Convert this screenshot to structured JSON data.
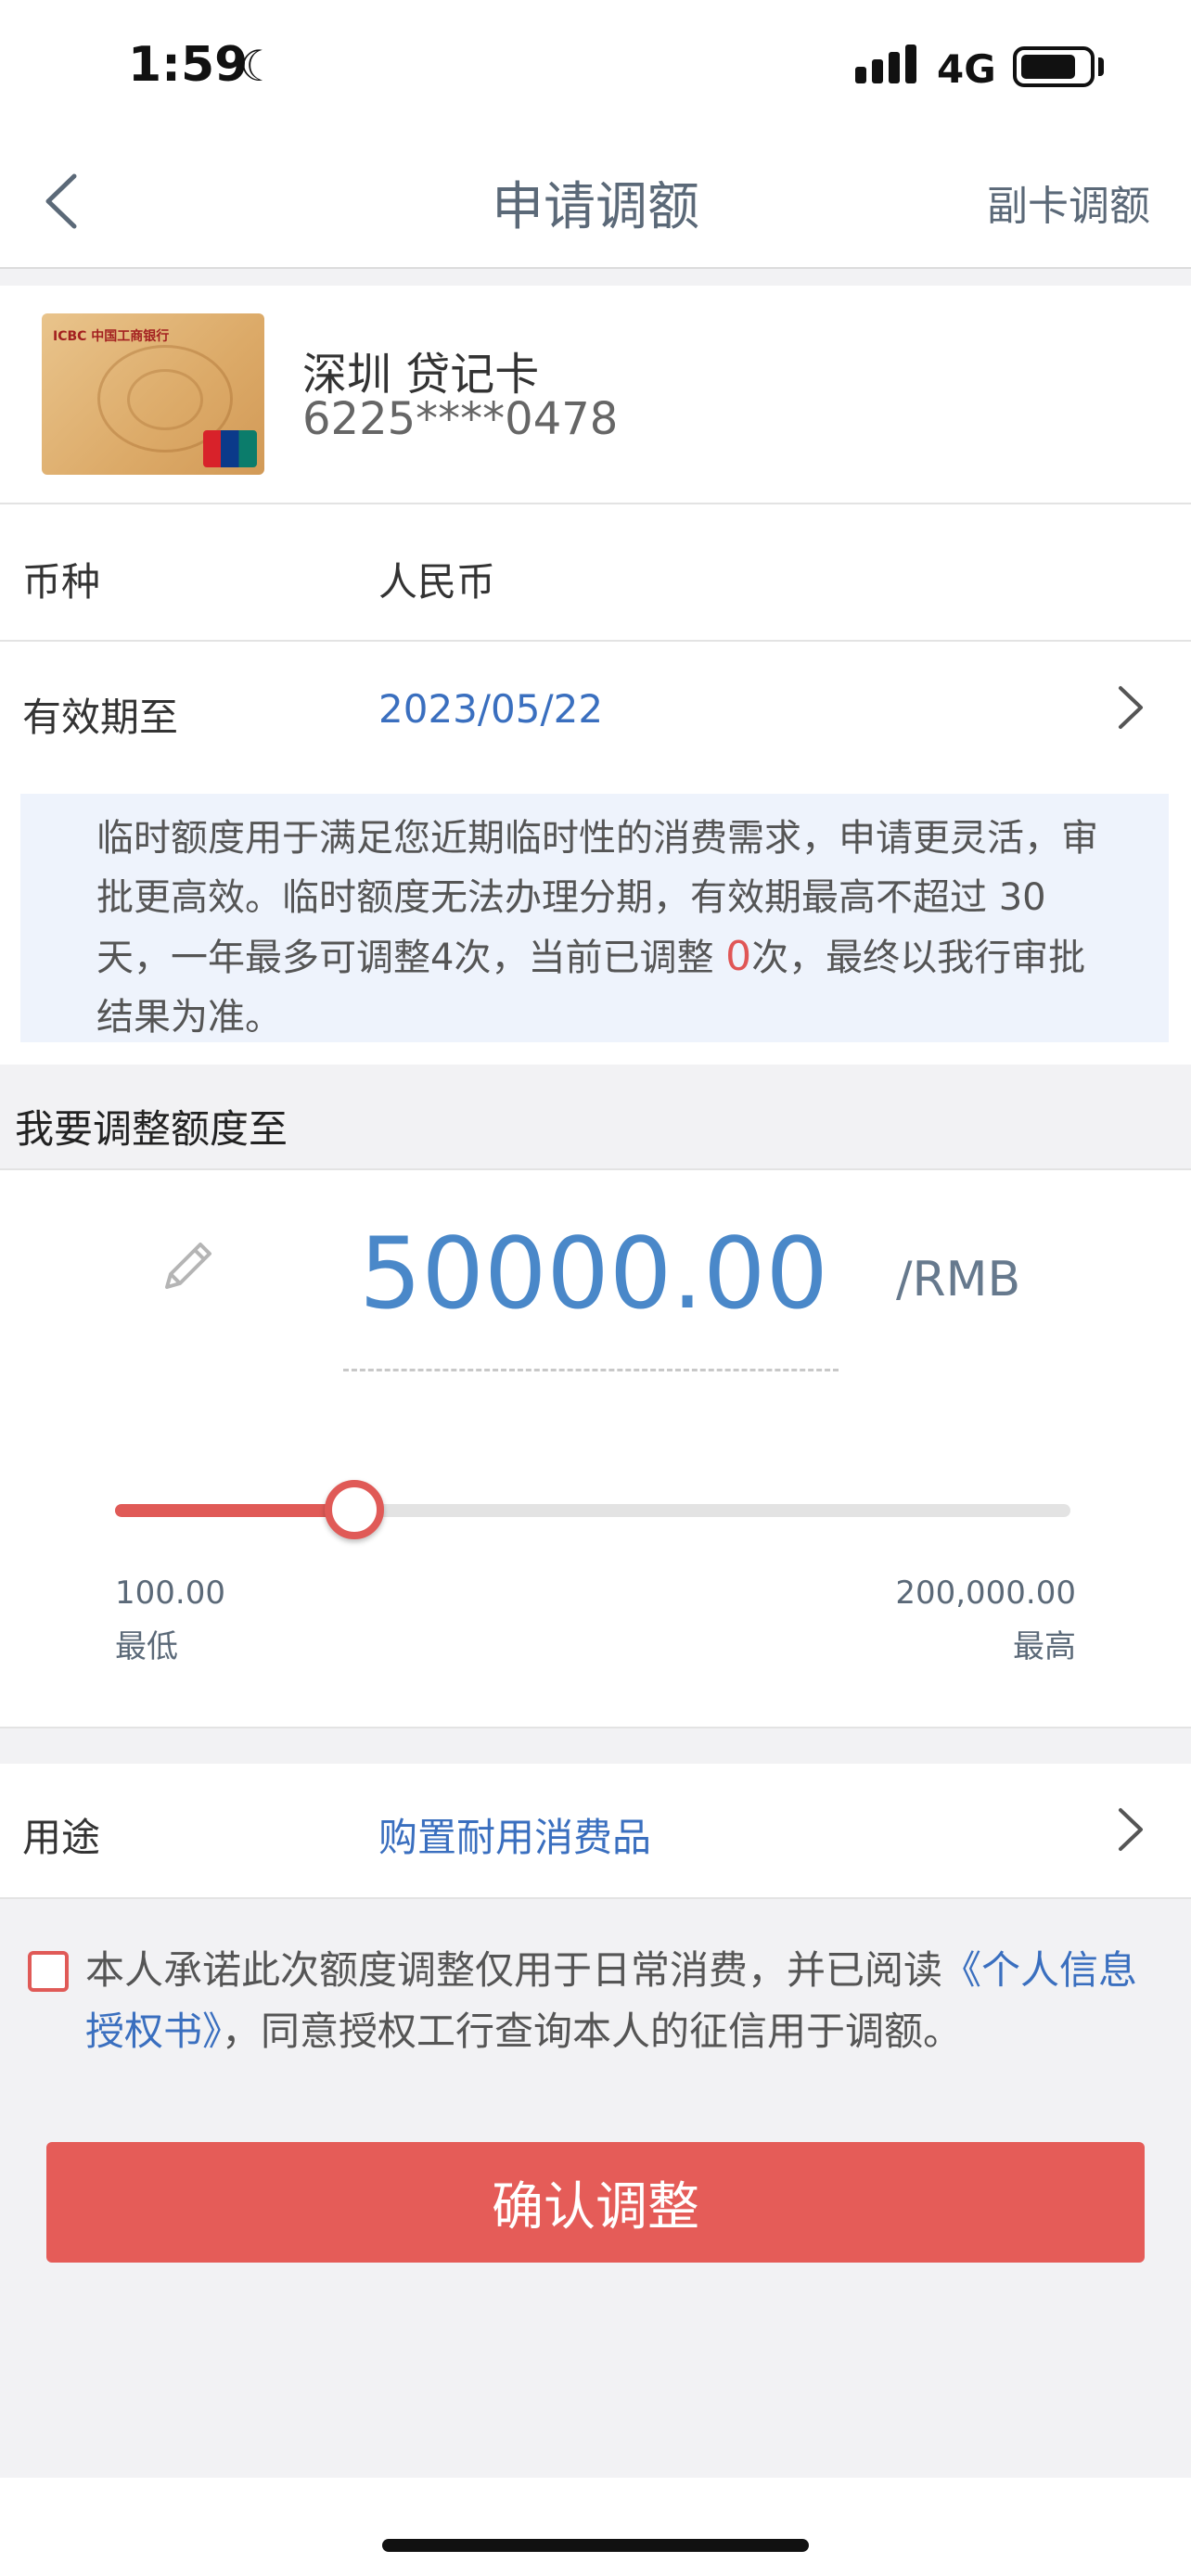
{
  "status": {
    "time": "1:59",
    "network": "4G",
    "battery_level": 0.8
  },
  "nav": {
    "title": "申请调额",
    "right_action": "副卡调额"
  },
  "card": {
    "name": "深圳  贷记卡",
    "number": "6225****0478",
    "logo_text": "ICBC 中国工商银行"
  },
  "currency": {
    "label": "币种",
    "value": "人民币"
  },
  "validity": {
    "label": "有效期至",
    "value": "2023/05/22"
  },
  "notice": {
    "text_before": "临时额度用于满足您近期临时性的消费需求，申请更灵活，审批更高效。临时额度无法办理分期，有效期最高不超过 30天，一年最多可调整4次，当前已调整 ",
    "count": "0",
    "text_after": "次，最终以我行审批结果为准。"
  },
  "adjust": {
    "section_title": "我要调整额度至",
    "amount": "50000.00",
    "unit": "/RMB",
    "min_value": "100.00",
    "min_label": "最低",
    "max_value": "200,000.00",
    "max_label": "最高",
    "slider_fraction": 0.25
  },
  "purpose": {
    "label": "用途",
    "value": "购置耐用消费品"
  },
  "agreement": {
    "text_before": "本人承诺此次额度调整仅用于日常消费，并已阅读",
    "link": "《个人信息授权书》",
    "text_after": "，同意授权工行查询本人的征信用于调额。",
    "checked": false
  },
  "confirm_label": "确认调整",
  "colors": {
    "accent_red": "#e05a57",
    "link_blue": "#3a6fbf",
    "amount_blue": "#4a88c9"
  }
}
